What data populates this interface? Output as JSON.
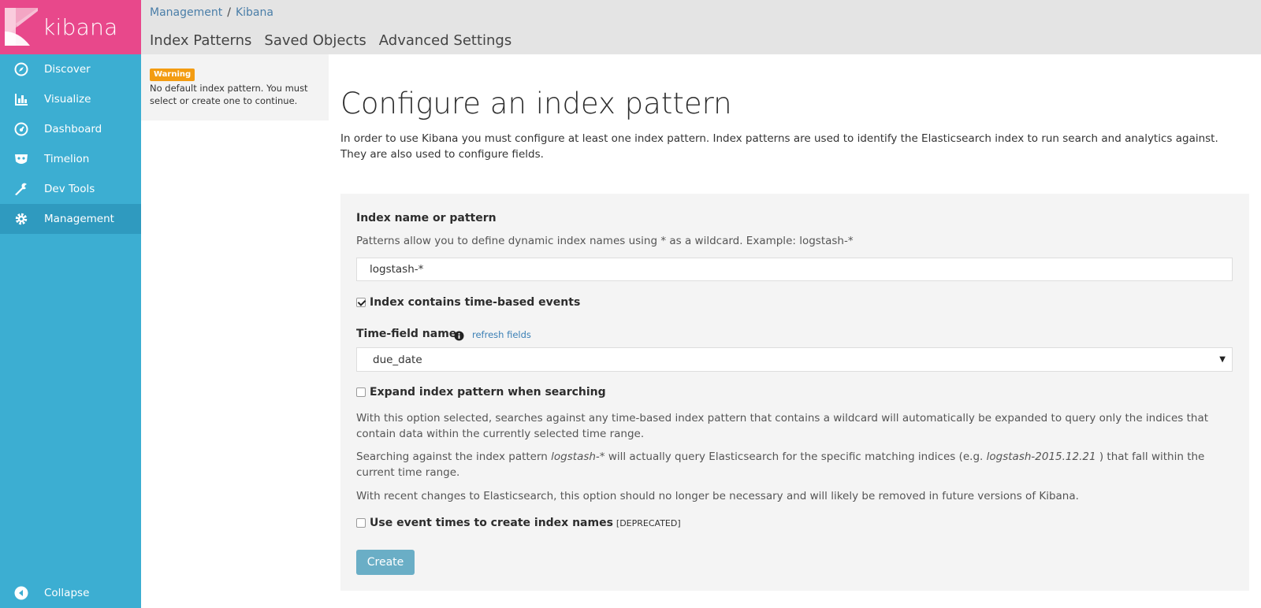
{
  "app": {
    "logo_text": "kibana",
    "brand_color": "#e8488b",
    "sidebar_color": "#3caed2"
  },
  "sidebar": {
    "items": [
      {
        "label": "Discover",
        "icon": "compass-icon"
      },
      {
        "label": "Visualize",
        "icon": "bar-chart-icon"
      },
      {
        "label": "Dashboard",
        "icon": "dashboard-gauge-icon"
      },
      {
        "label": "Timelion",
        "icon": "timelion-mask-icon"
      },
      {
        "label": "Dev Tools",
        "icon": "wrench-icon"
      },
      {
        "label": "Management",
        "icon": "gear-icon",
        "active": true
      }
    ],
    "collapse_label": "Collapse"
  },
  "breadcrumb": {
    "items": [
      "Management",
      "Kibana"
    ],
    "separator": "/"
  },
  "top_tabs": [
    "Index Patterns",
    "Saved Objects",
    "Advanced Settings"
  ],
  "warning": {
    "badge": "Warning",
    "text": "No default index pattern. You must select or create one to continue."
  },
  "main": {
    "title": "Configure an index pattern",
    "intro": "In order to use Kibana you must configure at least one index pattern. Index patterns are used to identify the Elasticsearch index to run search and analytics against. They are also used to configure fields."
  },
  "form": {
    "index_label": "Index name or pattern",
    "index_help": "Patterns allow you to define dynamic index names using * as a wildcard. Example: logstash-*",
    "index_value": "logstash-*",
    "time_based_label": "Index contains time-based events",
    "time_based_checked": true,
    "time_field_label": "Time-field name",
    "refresh_link": "refresh fields",
    "time_field_value": "due_date",
    "expand_label": "Expand index pattern when searching",
    "expand_checked": false,
    "expand_help_1": "With this option selected, searches against any time-based index pattern that contains a wildcard will automatically be expanded to query only the indices that contain data within the currently selected time range.",
    "expand_help_2_pre": "Searching against the index pattern ",
    "expand_help_2_em1": "logstash-*",
    "expand_help_2_mid": " will actually query Elasticsearch for the specific matching indices (e.g. ",
    "expand_help_2_em2": "logstash-2015.12.21",
    "expand_help_2_post": " ) that fall within the current time range.",
    "expand_help_3": "With recent changes to Elasticsearch, this option should no longer be necessary and will likely be removed in future versions of Kibana.",
    "event_times_label": "Use event times to create index names",
    "event_times_checked": false,
    "deprecated_tag": "[DEPRECATED]",
    "create_button": "Create"
  }
}
